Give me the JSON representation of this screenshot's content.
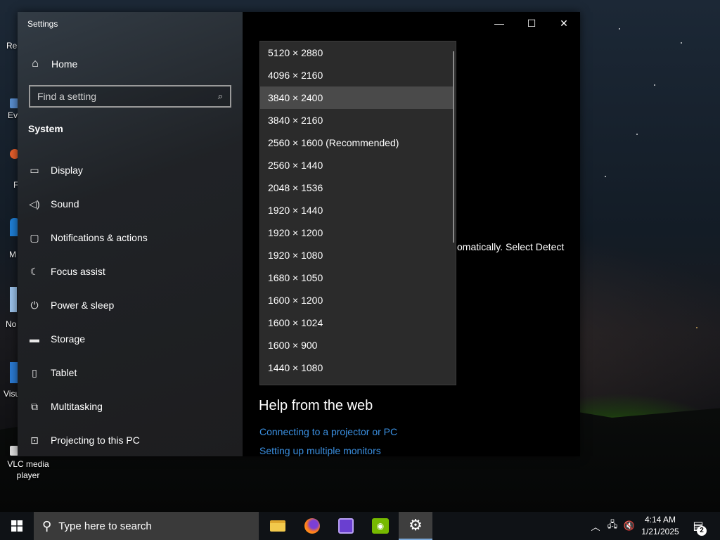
{
  "desktop": {
    "icons": [
      {
        "label": "Rec"
      },
      {
        "label": "Eve"
      },
      {
        "label": "F"
      },
      {
        "label": "M"
      },
      {
        "label": "No"
      },
      {
        "label": "Visu"
      },
      {
        "label": "VLC media player"
      }
    ]
  },
  "window": {
    "title": "Settings",
    "home_label": "Home",
    "search_placeholder": "Find a setting",
    "section_label": "System",
    "nav_items": [
      {
        "label": "Display",
        "icon": "display-icon"
      },
      {
        "label": "Sound",
        "icon": "speaker-icon"
      },
      {
        "label": "Notifications & actions",
        "icon": "notification-icon"
      },
      {
        "label": "Focus assist",
        "icon": "moon-icon"
      },
      {
        "label": "Power & sleep",
        "icon": "power-icon"
      },
      {
        "label": "Storage",
        "icon": "storage-icon"
      },
      {
        "label": "Tablet",
        "icon": "tablet-icon"
      },
      {
        "label": "Multitasking",
        "icon": "multitasking-icon"
      },
      {
        "label": "Projecting to this PC",
        "icon": "projector-icon"
      }
    ]
  },
  "resolution_dropdown": {
    "options": [
      "5120 × 2880",
      "4096 × 2160",
      "3840 × 2400",
      "3840 × 2160",
      "2560 × 1600 (Recommended)",
      "2560 × 1440",
      "2048 × 1536",
      "1920 × 1440",
      "1920 × 1200",
      "1920 × 1080",
      "1680 × 1050",
      "1600 × 1200",
      "1600 × 1024",
      "1600 × 900",
      "1440 × 1080"
    ],
    "selected": "3840 × 2400"
  },
  "main": {
    "partial_text": "omatically. Select Detect",
    "help_title": "Help from the web",
    "help_links": [
      "Connecting to a projector or PC",
      "Setting up multiple monitors"
    ]
  },
  "taskbar": {
    "search_placeholder": "Type here to search",
    "time": "4:14 AM",
    "date": "1/21/2025",
    "notification_count": "2",
    "apps": [
      "File Explorer",
      "Firefox",
      "Processor app",
      "NVIDIA",
      "Settings"
    ],
    "accent_color": "#7aa7d8"
  },
  "colors": {
    "link": "#3a8fe0",
    "selected_item": "#4a4a4a",
    "dropdown_bg": "#2b2b2b"
  }
}
